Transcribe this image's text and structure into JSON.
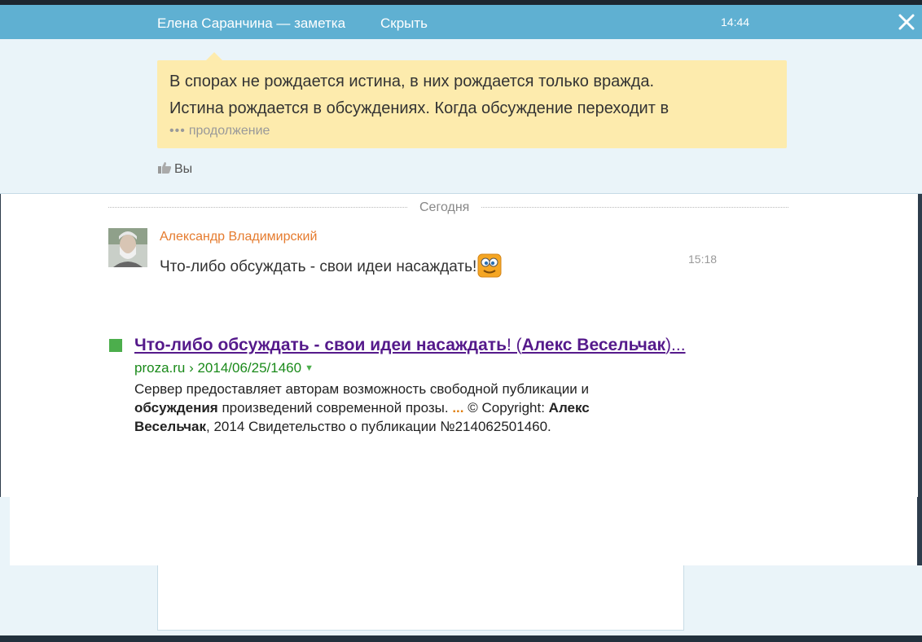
{
  "header": {
    "title": "Елена Саранчина — заметка",
    "hide_label": "Скрыть",
    "time": "14:44",
    "close_icon": "close-icon"
  },
  "note": {
    "line1": "В спорах не рождается истина, в них рождается только вражда.",
    "line2": "Истина рождается в обсуждениях. Когда обсуждение переходит в",
    "more_dots": "•••",
    "more_label": "продолжение"
  },
  "likes": {
    "icon": "thumbs-up-icon",
    "label": "Вы"
  },
  "feed": {
    "date_divider": "Сегодня",
    "comment": {
      "author": "Александр Владимирский",
      "text": "Что-либо обсуждать - свои идеи насаждать!",
      "emoji": "smiley-icon",
      "time": "15:18"
    }
  },
  "search_result": {
    "title_bold": "Что-либо обсуждать - свои идеи насаждать",
    "title_mid": "! (",
    "title_bold2": "Алекс Весельчак",
    "title_end": ")...",
    "url": "proza.ru › 2014/06/25/1460",
    "snippet_1": "Сервер предоставляет авторам возможность свободной публикации и ",
    "snippet_bold1": "обсуждения",
    "snippet_2": " произведений современной прозы. ",
    "snippet_ellipsis": "...",
    "snippet_3": " © Copyright: ",
    "snippet_bold2": "Алекс Весельчак",
    "snippet_4": ", 2014 Свидетельство о публикации №214062501460."
  },
  "colors": {
    "header_bg": "#5fb0d2",
    "note_bg": "#fdebad",
    "author": "#e57b2e",
    "link": "#551a8b",
    "url": "#1a8a1a"
  }
}
